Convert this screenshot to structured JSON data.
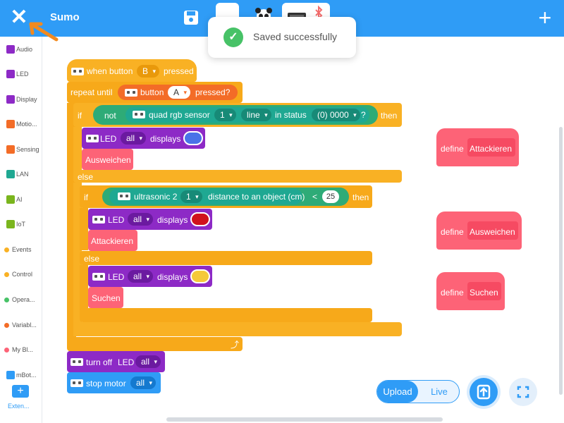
{
  "topbar": {
    "close_icon": "close-icon",
    "project_title": "Sumo",
    "save_icon": "save-icon",
    "add_icon": "plus-icon",
    "accent_color": "#2f9cf6"
  },
  "toast": {
    "message": "Saved successfully",
    "icon": "check-circle-icon"
  },
  "palette": {
    "categories": [
      {
        "label": "Audio",
        "color": "#8d2ac6"
      },
      {
        "label": "LED",
        "color": "#8d2ac6"
      },
      {
        "label": "Display",
        "color": "#8d2ac6"
      },
      {
        "label": "Motio...",
        "color": "#f36c27"
      },
      {
        "label": "Sensing",
        "color": "#f36c27"
      },
      {
        "label": "LAN",
        "color": "#1fa892"
      },
      {
        "label": "AI",
        "color": "#7ab51d"
      },
      {
        "label": "IoT",
        "color": "#7ab51d"
      },
      {
        "label": "Events",
        "color": "#f9b124"
      },
      {
        "label": "Control",
        "color": "#f9b124"
      },
      {
        "label": "Opera...",
        "color": "#47c267"
      },
      {
        "label": "Variabl...",
        "color": "#f36c27"
      },
      {
        "label": "My Bl...",
        "color": "#fd6377"
      },
      {
        "label": "mBot...",
        "color": "#2f9cf6"
      }
    ],
    "extension_label": "Exten..."
  },
  "script": {
    "when_button": "when button",
    "when_button_value": "B",
    "when_pressed": "pressed",
    "repeat_until": "repeat until",
    "repeat_button": "button",
    "repeat_button_value": "A",
    "repeat_pressed": "pressed?",
    "if1": "if",
    "not": "not",
    "quad_sensor": "quad rgb sensor",
    "quad_sensor_num": "1",
    "quad_line": "line",
    "quad_in_status": "in status",
    "quad_status_value": "(0) 0000",
    "quad_question": "?",
    "then1": "then",
    "led1": "LED",
    "led1_target": "all",
    "led1_displays": "displays",
    "led1_color": "#4a72e8",
    "call_ausweichen": "Ausweichen",
    "else1": "else",
    "if2": "if",
    "ultrasonic": "ultrasonic 2",
    "ultrasonic_num": "1",
    "ultrasonic_distance": "distance to an object (cm)",
    "lt": "<",
    "lt_value": "25",
    "then2": "then",
    "led2": "LED",
    "led2_target": "all",
    "led2_displays": "displays",
    "led2_color": "#d0121d",
    "call_attackieren": "Attackieren",
    "else2": "else",
    "led3": "LED",
    "led3_target": "all",
    "led3_displays": "displays",
    "led3_color": "#f5c93a",
    "call_suchen": "Suchen",
    "turn_off": "turn off",
    "turn_off_led": "LED",
    "turn_off_target": "all",
    "stop_motor": "stop motor",
    "stop_motor_target": "all"
  },
  "defines": [
    {
      "define_label": "define",
      "name": "Attackieren"
    },
    {
      "define_label": "define",
      "name": "Ausweichen"
    },
    {
      "define_label": "define",
      "name": "Suchen"
    }
  ],
  "bottom": {
    "upload_label": "Upload",
    "live_label": "Live",
    "upload_icon": "upload-icon",
    "fullscreen_icon": "fullscreen-icon"
  }
}
